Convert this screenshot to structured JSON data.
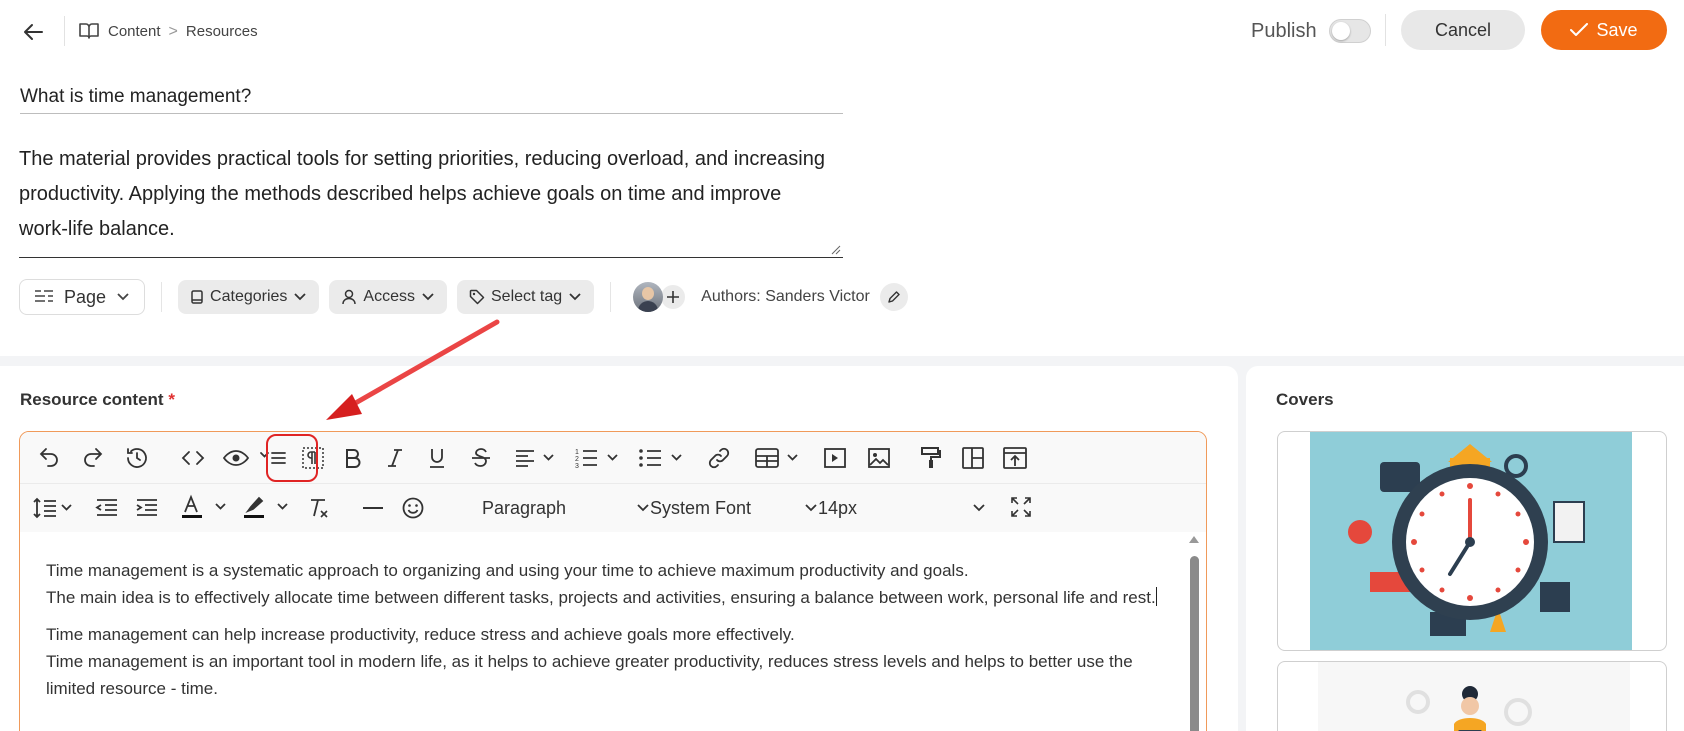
{
  "header": {
    "breadcrumb": [
      "Content",
      "Resources"
    ],
    "breadcrumb_sep": ">",
    "publish_label": "Publish",
    "publish_on": false,
    "cancel_label": "Cancel",
    "save_label": "Save"
  },
  "resource": {
    "title": "What is time management?",
    "description": "The material provides practical tools for setting priorities, reducing overload, and increasing productivity. Applying the methods described helps achieve goals on time and improve work-life balance."
  },
  "meta": {
    "page_label": "Page",
    "categories_label": "Categories",
    "access_label": "Access",
    "tag_label": "Select tag",
    "authors_label": "Authors: Sanders Victor"
  },
  "editor": {
    "section_title": "Resource content",
    "required_mark": "*",
    "paragraph_select": "Paragraph",
    "font_select": "System Font",
    "size_select": "14px",
    "content": {
      "p1_line1": "Time management is a systematic approach to organizing and using your time to achieve maximum productivity and goals.",
      "p1_line2": "The main idea is to effectively allocate time between different tasks, projects and activities, ensuring a balance between work, personal life and rest.",
      "p2_line1": "Time management can help increase productivity, reduce stress and achieve goals more effectively.",
      "p2_line2": "Time management is an important tool in modern life, as it helps to achieve greater productivity, reduces stress levels and helps to better use the limited resource - time."
    }
  },
  "covers": {
    "title": "Covers"
  },
  "colors": {
    "accent": "#f26b12",
    "highlight": "#e02424",
    "editor_border": "#f09a5a"
  }
}
